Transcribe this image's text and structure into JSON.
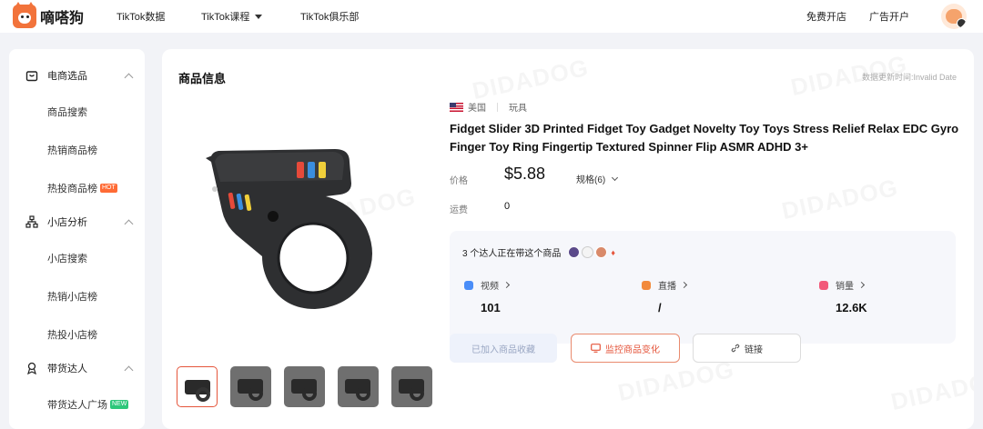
{
  "header": {
    "logo_text": "嘀嗒狗",
    "nav": [
      "TikTok数据",
      "TikTok课程",
      "TikTok俱乐部"
    ],
    "right_links": [
      "免费开店",
      "广告开户"
    ]
  },
  "sidebar": {
    "sections": [
      {
        "label": "电商选品",
        "icon": "shopping-bag-icon",
        "items": [
          {
            "label": "商品搜索"
          },
          {
            "label": "热销商品榜"
          },
          {
            "label": "热投商品榜",
            "badge": "HOT"
          }
        ]
      },
      {
        "label": "小店分析",
        "icon": "network-icon",
        "items": [
          {
            "label": "小店搜索"
          },
          {
            "label": "热销小店榜"
          },
          {
            "label": "热投小店榜"
          }
        ]
      },
      {
        "label": "带货达人",
        "icon": "influencer-icon",
        "items": [
          {
            "label": "带货达人广场",
            "badge": "NEW"
          }
        ]
      }
    ]
  },
  "main": {
    "title": "商品信息",
    "update_text": "数据更新时间:Invalid Date",
    "watermark": "DIDADOG",
    "country": "美国",
    "category": "玩具",
    "product_title": "Fidget Slider 3D Printed Fidget Toy Gadget Novelty Toy Toys Stress Relief Relax EDC Gyro Finger Toy Ring Fingertip Textured Spinner Flip ASMR ADHD 3+",
    "price_label": "价格",
    "price": "$5.88",
    "spec_label": "规格(6)",
    "shipping_label": "运费",
    "shipping_value": "0",
    "promoters_text": "3 个达人正在带这个商品",
    "stats": [
      {
        "label": "视频",
        "value": "101",
        "color": "#4a8df8"
      },
      {
        "label": "直播",
        "value": "/",
        "color": "#f28a3c"
      },
      {
        "label": "销量",
        "value": "12.6K",
        "color": "#f25a7a"
      }
    ],
    "buttons": {
      "favorite": "已加入商品收藏",
      "monitor": "监控商品变化",
      "link": "链接"
    }
  },
  "colors": {
    "accent": "#e5553b",
    "brand": "#f2733b"
  }
}
